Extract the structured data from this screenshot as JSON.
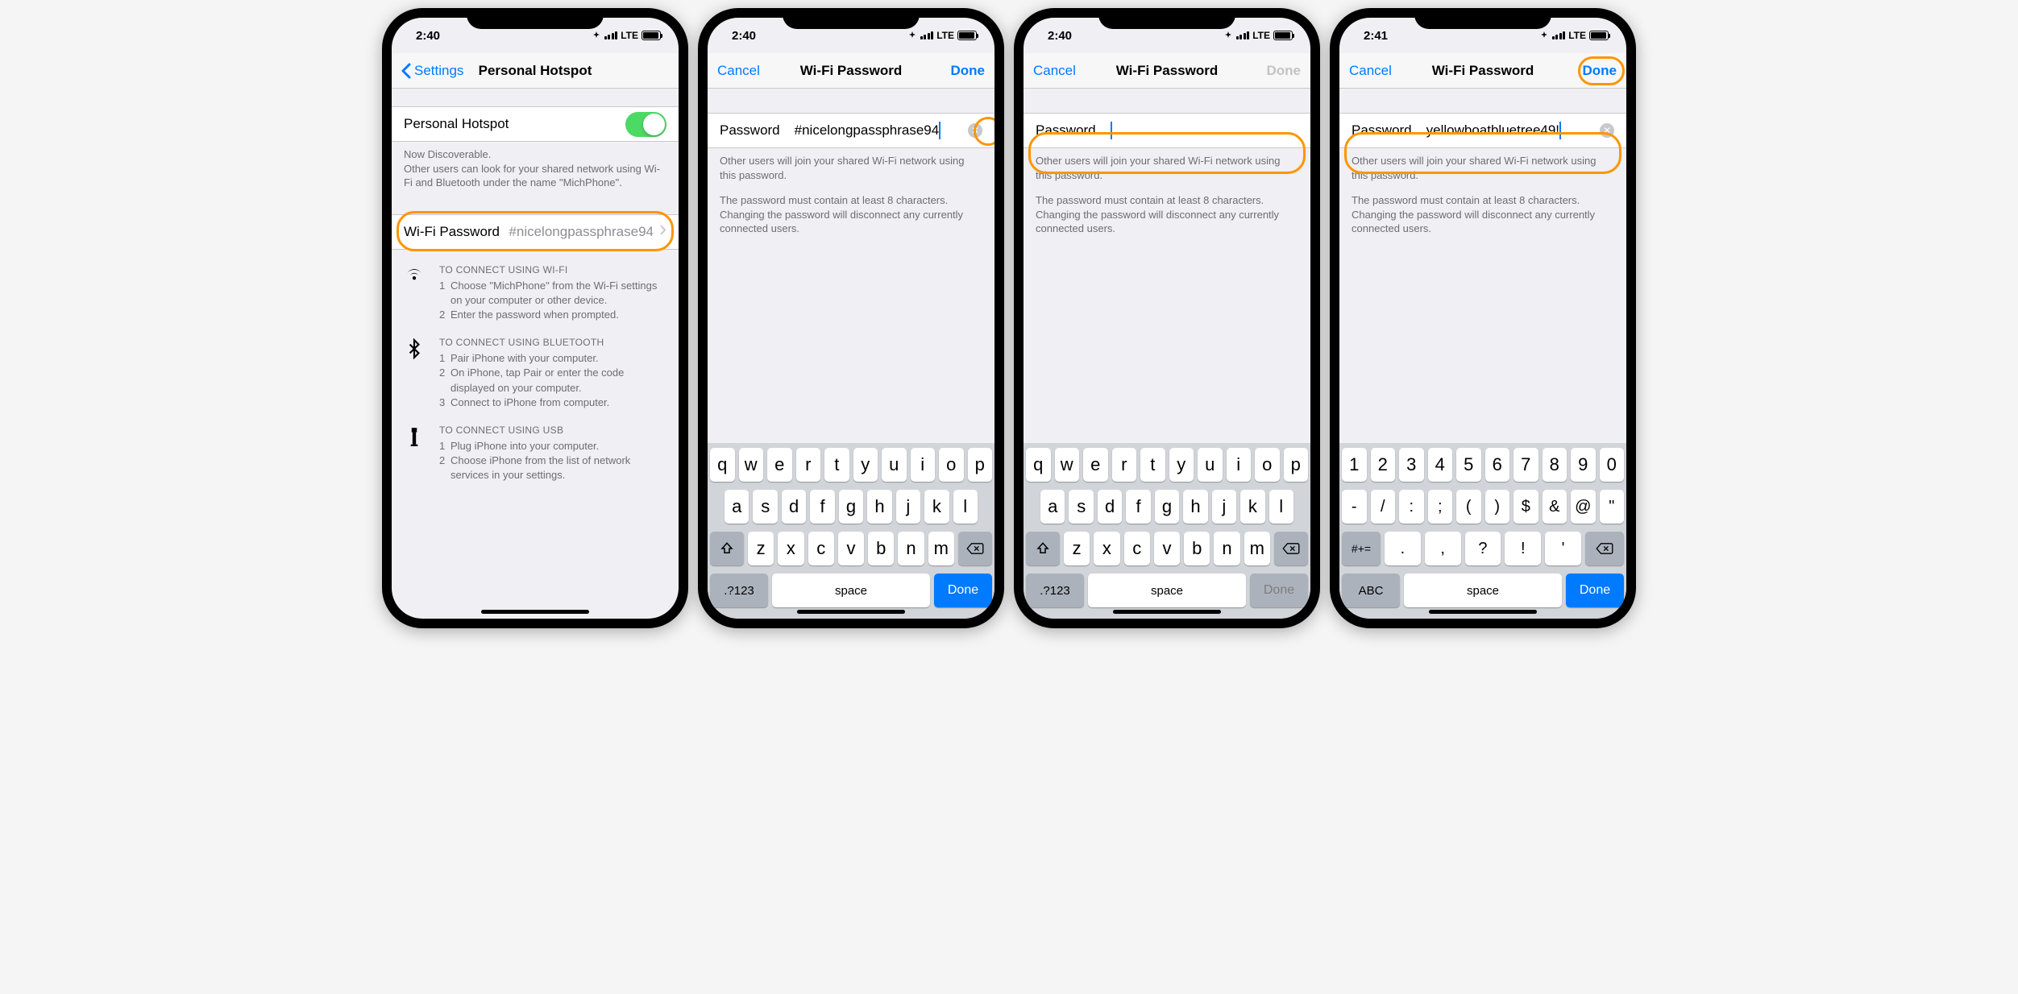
{
  "status": {
    "time1": "2:40",
    "time2": "2:41",
    "carrier": "LTE"
  },
  "screen1": {
    "back": "Settings",
    "title": "Personal Hotspot",
    "toggle_label": "Personal Hotspot",
    "discoverable": "Now Discoverable.",
    "discover_sub": "Other users can look for your shared network using Wi-Fi and Bluetooth under the name \"MichPhone\".",
    "wifi_label": "Wi-Fi Password",
    "wifi_value": "#nicelongpassphrase94",
    "wifi_title": "TO CONNECT USING WI-FI",
    "wifi_steps": [
      "Choose \"MichPhone\" from the Wi-Fi settings on your computer or other device.",
      "Enter the password when prompted."
    ],
    "bt_title": "TO CONNECT USING BLUETOOTH",
    "bt_steps": [
      "Pair iPhone with your computer.",
      "On iPhone, tap Pair or enter the code displayed on your computer.",
      "Connect to iPhone from computer."
    ],
    "usb_title": "TO CONNECT USING USB",
    "usb_steps": [
      "Plug iPhone into your computer.",
      "Choose iPhone from the list of network services in your settings."
    ]
  },
  "pwd_screen": {
    "cancel": "Cancel",
    "done": "Done",
    "title": "Wi-Fi Password",
    "label": "Password",
    "help1": "Other users will join your shared Wi-Fi network using this password.",
    "help2": "The password must contain at least 8 characters. Changing the password will disconnect any currently connected users.",
    "val1": "#nicelongpassphrase94",
    "val2": "",
    "val3": "yellowboatbluetree49!"
  },
  "kb": {
    "r1": [
      "q",
      "w",
      "e",
      "r",
      "t",
      "y",
      "u",
      "i",
      "o",
      "p"
    ],
    "r2": [
      "a",
      "s",
      "d",
      "f",
      "g",
      "h",
      "j",
      "k",
      "l"
    ],
    "r3": [
      "z",
      "x",
      "c",
      "v",
      "b",
      "n",
      "m"
    ],
    "mode": ".?123",
    "space": "space",
    "done": "Done",
    "n1": [
      "1",
      "2",
      "3",
      "4",
      "5",
      "6",
      "7",
      "8",
      "9",
      "0"
    ],
    "n2": [
      "-",
      "/",
      ":",
      ";",
      "(",
      ")",
      "$",
      "&",
      "@",
      "\""
    ],
    "n3": [
      ".",
      ",",
      "?",
      "!",
      "'"
    ],
    "sym_mode": "#+=",
    "abc": "ABC"
  }
}
